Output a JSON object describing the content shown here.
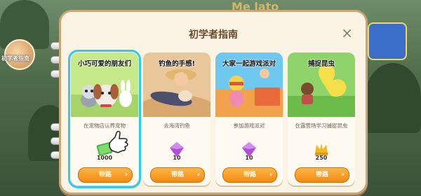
{
  "guide": {
    "title": "初学者指南",
    "close_icon": "×",
    "cards": [
      {
        "title": "小巧可爱的朋友们",
        "subtitle": "在宠物店认养宠物",
        "reward": "1000",
        "reward_icon": "cash-icon",
        "button": "带路",
        "selected": true
      },
      {
        "title": "钓鱼的手感!",
        "subtitle": "去海湾钓鱼",
        "reward": "10",
        "reward_icon": "gem-icon",
        "button": "带路",
        "selected": false
      },
      {
        "title": "大家一起游戏派对",
        "subtitle": "参加游戏派对",
        "reward": "10",
        "reward_icon": "gem-icon",
        "button": "带路",
        "selected": false
      },
      {
        "title": "捕捉昆虫",
        "subtitle": "在露营场学习捕捉昆虫",
        "reward": "250",
        "reward_icon": "crown-coin-icon",
        "button": "带路",
        "selected": false
      }
    ]
  },
  "background": {
    "left_label": "初学者指南",
    "top_text": "Me lato"
  },
  "colors": {
    "panel_bg": "#fbf3e4",
    "button": "#f28a12",
    "selected_outline": "#2fc9f2",
    "title_text": "#6b4a2e"
  }
}
